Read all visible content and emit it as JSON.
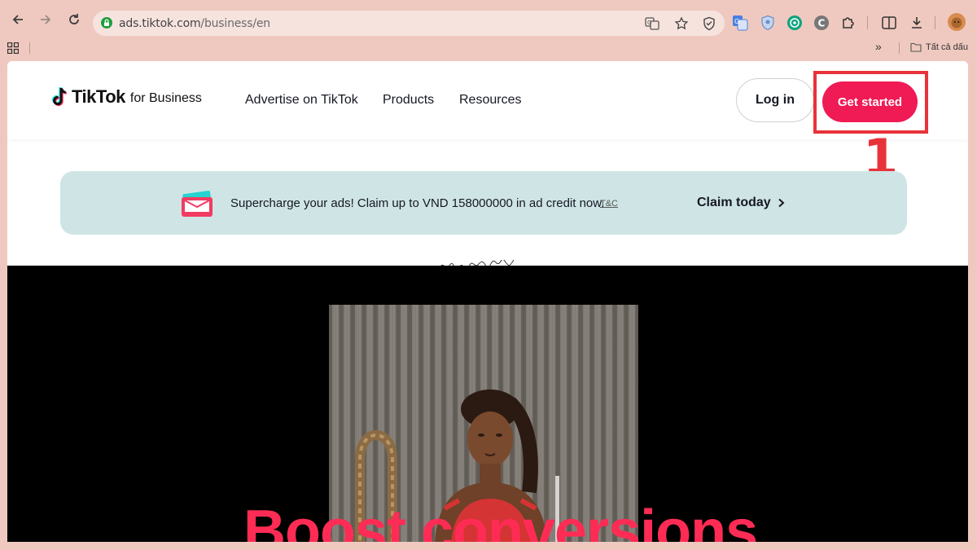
{
  "browser": {
    "url_host": "ads.tiktok.com",
    "url_path": "/business/en",
    "bookmarks_all_label": "Tất cả dấu"
  },
  "header": {
    "logo_word": "TikTok",
    "logo_sub": "for Business",
    "nav": [
      "Advertise on TikTok",
      "Products",
      "Resources"
    ],
    "login_label": "Log in",
    "get_started_label": "Get started"
  },
  "annotation": {
    "step": "1",
    "color": "#e8323a"
  },
  "promo": {
    "text": "Supercharge your ads! Claim up to VND 158000000 in ad credit now.",
    "tc": "T&C",
    "claim": "Claim today"
  },
  "hero": {
    "headline": "Boost conversions"
  },
  "colors": {
    "brand_pink": "#f01a55",
    "promo_bg": "#cfe5e5"
  }
}
